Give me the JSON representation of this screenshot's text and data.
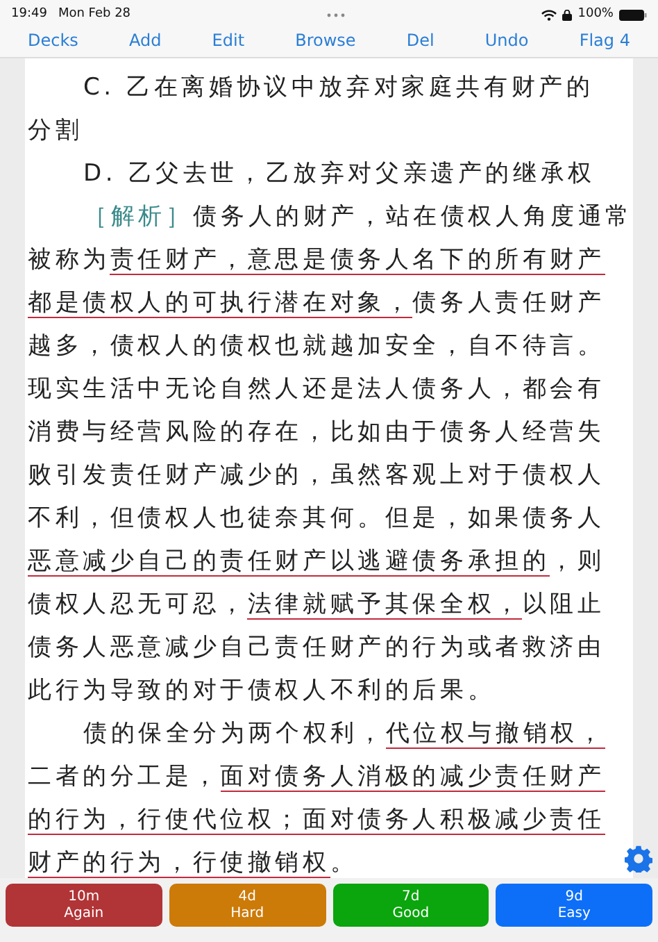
{
  "status_bar": {
    "time": "19:49",
    "date": "Mon Feb 28",
    "battery": "100%"
  },
  "toolbar": [
    "Decks",
    "Add",
    "Edit",
    "Browse",
    "Del",
    "Undo",
    "Flag 4"
  ],
  "page_lines": [
    {
      "indent": true,
      "segments": [
        {
          "text": "C. 乙在离婚协议中放弃对家庭共有财产的",
          "kind": "plain"
        }
      ]
    },
    {
      "indent": false,
      "segments": [
        {
          "text": "分割",
          "kind": "plain"
        }
      ]
    },
    {
      "indent": true,
      "segments": [
        {
          "text": "D. 乙父去世，乙放弃对父亲遗产的继承权",
          "kind": "plain"
        }
      ]
    },
    {
      "indent": true,
      "segments": [
        {
          "text": "［解析］",
          "kind": "label"
        },
        {
          "text": "债务人的财产，站在债权人角度通常",
          "kind": "plain"
        }
      ]
    },
    {
      "indent": false,
      "segments": [
        {
          "text": "被称为",
          "kind": "plain"
        },
        {
          "text": "责任财产，意思是债务人名下的所有财产",
          "kind": "underline"
        }
      ]
    },
    {
      "indent": false,
      "segments": [
        {
          "text": "都是债权人的可执行潜在对象，",
          "kind": "underline"
        },
        {
          "text": "债务人责任财产",
          "kind": "plain"
        }
      ]
    },
    {
      "indent": false,
      "segments": [
        {
          "text": "越多，债权人的债权也就越加安全，自不待言。",
          "kind": "plain"
        }
      ]
    },
    {
      "indent": false,
      "segments": [
        {
          "text": "现实生活中无论自然人还是法人债务人，都会有",
          "kind": "plain"
        }
      ]
    },
    {
      "indent": false,
      "segments": [
        {
          "text": "消费与经营风险的存在，比如由于债务人经营失",
          "kind": "plain"
        }
      ]
    },
    {
      "indent": false,
      "segments": [
        {
          "text": "败引发责任财产减少的，虽然客观上对于债权人",
          "kind": "plain"
        }
      ]
    },
    {
      "indent": false,
      "segments": [
        {
          "text": "不利，但债权人也徒奈其何。但是，如果债务人",
          "kind": "plain"
        }
      ]
    },
    {
      "indent": false,
      "segments": [
        {
          "text": "恶意减少自己的责任财产以逃避债务承担的",
          "kind": "underline"
        },
        {
          "text": "，则",
          "kind": "plain"
        }
      ]
    },
    {
      "indent": false,
      "segments": [
        {
          "text": "债权人忍无可忍，",
          "kind": "plain"
        },
        {
          "text": "法律就赋予其保全权，",
          "kind": "underline"
        },
        {
          "text": "以阻止",
          "kind": "plain"
        }
      ]
    },
    {
      "indent": false,
      "segments": [
        {
          "text": "债务人恶意减少自己责任财产的行为或者救济由",
          "kind": "plain"
        }
      ]
    },
    {
      "indent": false,
      "segments": [
        {
          "text": "此行为导致的对于债权人不利的后果。",
          "kind": "plain"
        }
      ]
    },
    {
      "indent": true,
      "segments": [
        {
          "text": "债的保全分为两个权利，",
          "kind": "plain"
        },
        {
          "text": "代位权与撤销权，",
          "kind": "underline"
        }
      ]
    },
    {
      "indent": false,
      "segments": [
        {
          "text": "二者的分工是，",
          "kind": "plain"
        },
        {
          "text": "面对债务人消极的减少责任财产",
          "kind": "underline"
        }
      ]
    },
    {
      "indent": false,
      "segments": [
        {
          "text": "的行为，行使代位权；",
          "kind": "underline"
        },
        {
          "text": "面对债务人积极减少责任",
          "kind": "underline"
        }
      ]
    },
    {
      "indent": false,
      "segments": [
        {
          "text": "财产的行为，行使撤销权",
          "kind": "underline"
        },
        {
          "text": "。",
          "kind": "plain"
        }
      ]
    }
  ],
  "answer_buttons": [
    {
      "interval": "10m",
      "label": "Again",
      "color": "#b13436"
    },
    {
      "interval": "4d",
      "label": "Hard",
      "color": "#cc7a08"
    },
    {
      "interval": "7d",
      "label": "Good",
      "color": "#0ba50d"
    },
    {
      "interval": "9d",
      "label": "Easy",
      "color": "#0d6ff8"
    }
  ]
}
